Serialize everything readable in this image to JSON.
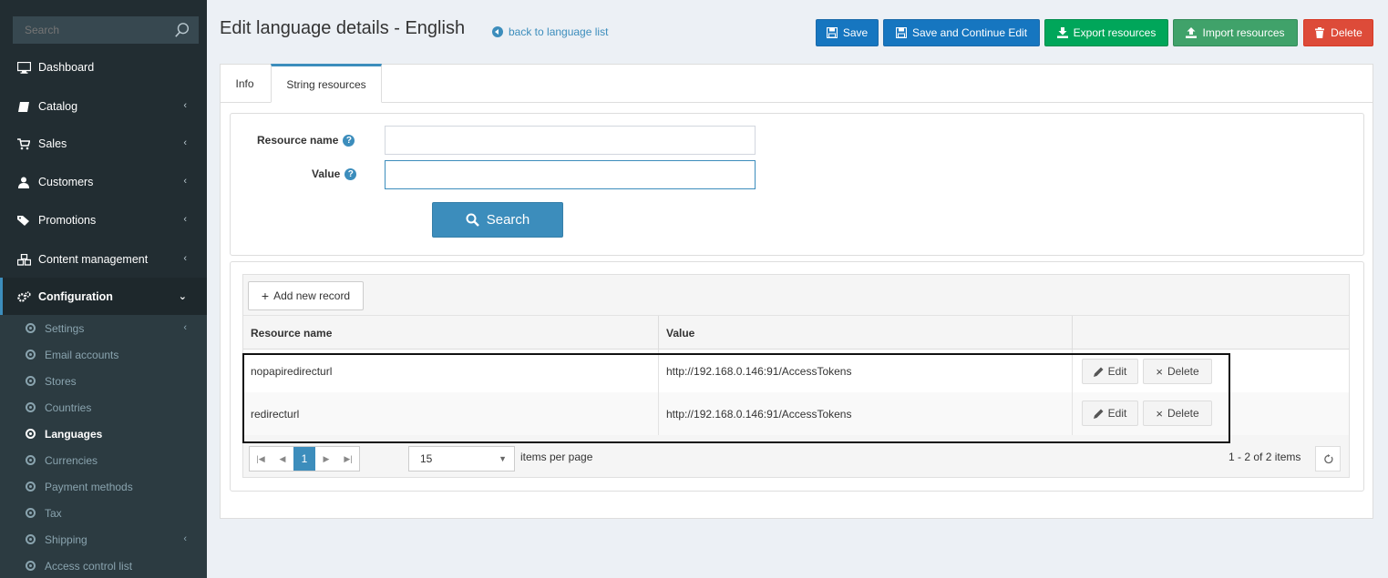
{
  "sidebar": {
    "search_placeholder": "Search",
    "items": [
      {
        "label": "Dashboard",
        "icon": "monitor-icon",
        "chevron": ""
      },
      {
        "label": "Catalog",
        "icon": "book-icon",
        "chevron": "‹"
      },
      {
        "label": "Sales",
        "icon": "cart-icon",
        "chevron": "‹"
      },
      {
        "label": "Customers",
        "icon": "user-icon",
        "chevron": "‹"
      },
      {
        "label": "Promotions",
        "icon": "tags-icon",
        "chevron": "‹"
      },
      {
        "label": "Content management",
        "icon": "cubes-icon",
        "chevron": "‹"
      },
      {
        "label": "Configuration",
        "icon": "gears-icon",
        "chevron": "⌄"
      }
    ],
    "sub_items": [
      {
        "label": "Settings",
        "chevron": "‹"
      },
      {
        "label": "Email accounts",
        "chevron": ""
      },
      {
        "label": "Stores",
        "chevron": ""
      },
      {
        "label": "Countries",
        "chevron": ""
      },
      {
        "label": "Languages",
        "chevron": ""
      },
      {
        "label": "Currencies",
        "chevron": ""
      },
      {
        "label": "Payment methods",
        "chevron": ""
      },
      {
        "label": "Tax",
        "chevron": ""
      },
      {
        "label": "Shipping",
        "chevron": "‹"
      },
      {
        "label": "Access control list",
        "chevron": ""
      }
    ]
  },
  "header": {
    "title": "Edit language details - English",
    "back_link": "back to language list"
  },
  "toolbar": {
    "save": "Save",
    "save_continue": "Save and Continue Edit",
    "export": "Export resources",
    "import": "Import resources",
    "delete": "Delete"
  },
  "tabs": [
    "Info",
    "String resources"
  ],
  "search_form": {
    "resource_name_label": "Resource name",
    "value_label": "Value",
    "resource_name_value": "",
    "value_value": "",
    "search_button": "Search"
  },
  "grid": {
    "add_button": "Add new record",
    "columns": [
      "Resource name",
      "Value",
      ""
    ],
    "rows": [
      {
        "name": "nopapiredirecturl",
        "value": "http://192.168.0.146:91/AccessTokens"
      },
      {
        "name": "redirecturl",
        "value": "http://192.168.0.146:91/AccessTokens"
      }
    ],
    "edit_label": "Edit",
    "delete_label": "Delete",
    "current_page": "1",
    "page_size": "15",
    "items_per_page": "items per page",
    "summary": "1 - 2 of 2 items"
  },
  "colors": {
    "sidebar_bg": "#222d32",
    "primary": "#1676c0",
    "success": "#00a65a",
    "danger": "#dd4b39"
  }
}
